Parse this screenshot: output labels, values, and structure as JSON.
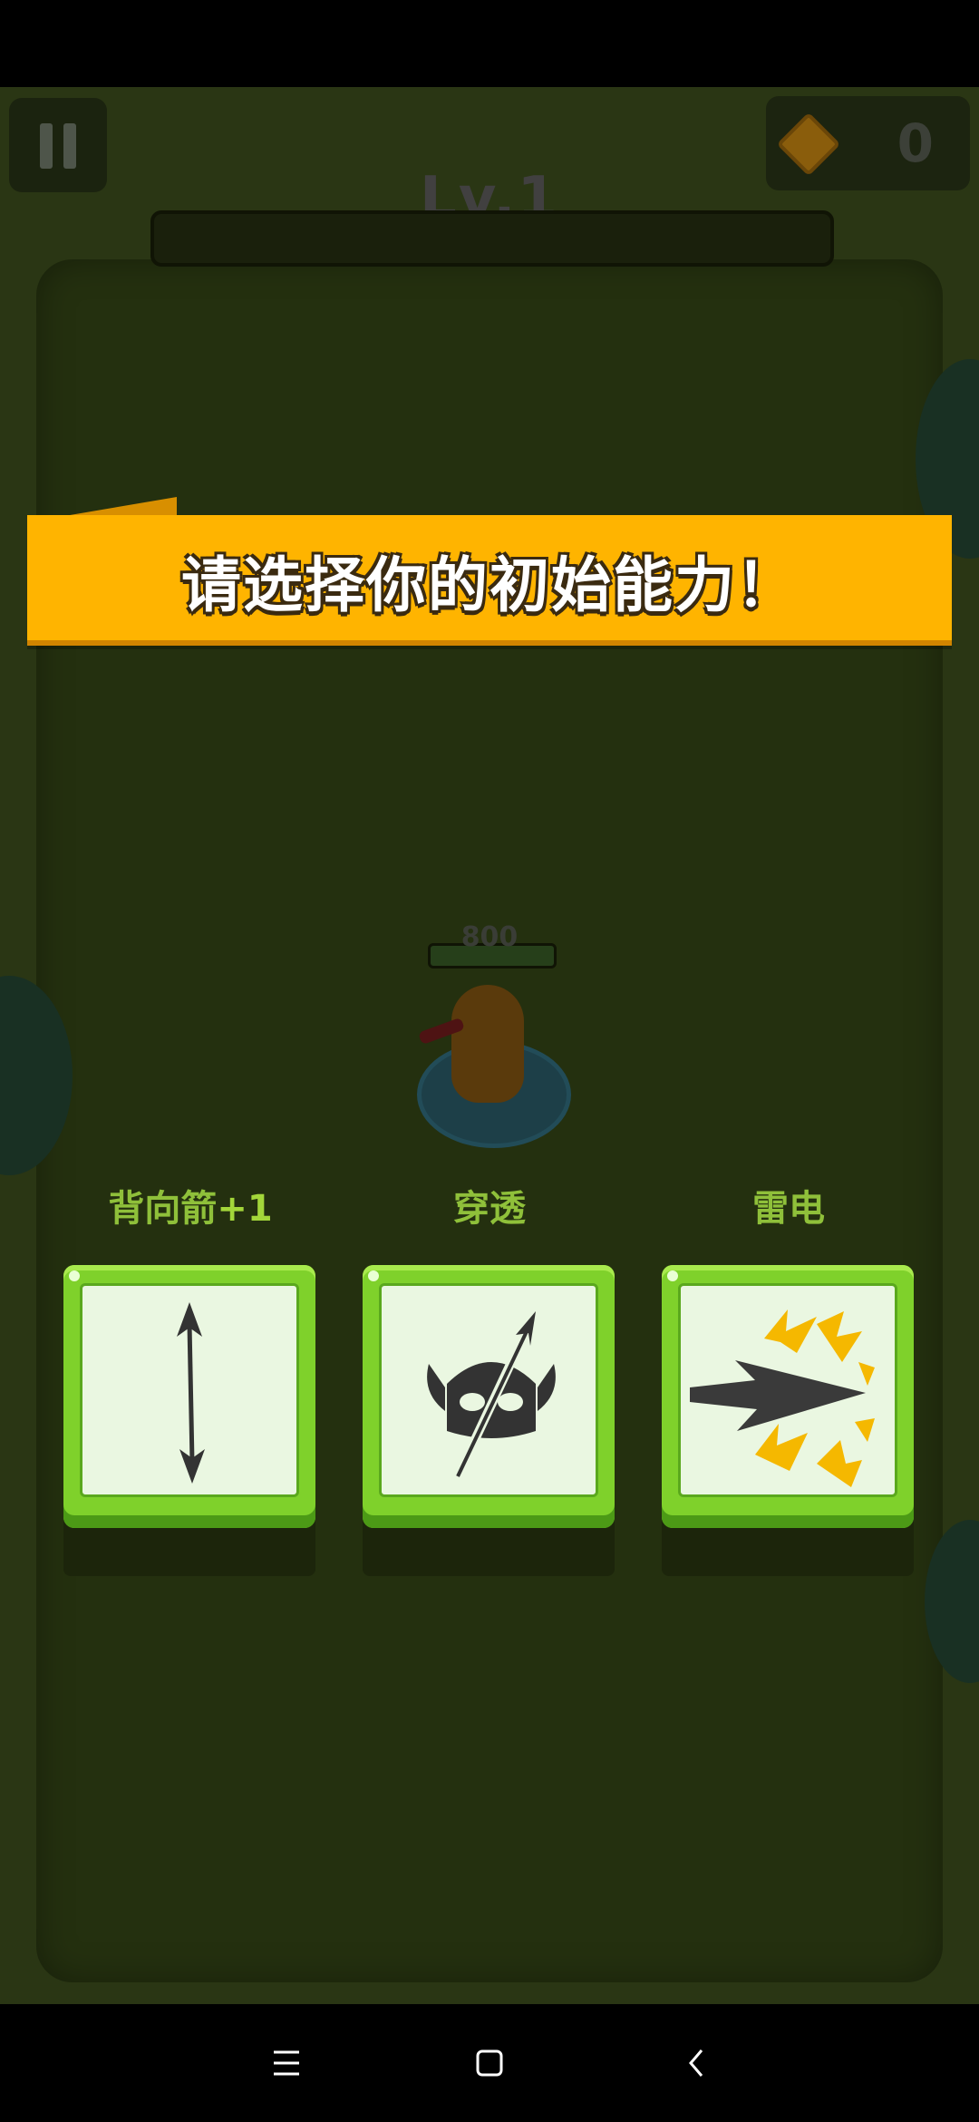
{
  "hud": {
    "level_label": "Lv.1",
    "gem_count": "0"
  },
  "banner": {
    "text": "请选择你的初始能力！"
  },
  "player": {
    "hp_value": "800"
  },
  "abilities": [
    {
      "label": "背向箭",
      "suffix": "+1",
      "icon": "double-arrow-icon"
    },
    {
      "label": "穿透",
      "suffix": "",
      "icon": "pierce-helmet-icon"
    },
    {
      "label": "雷电",
      "suffix": "",
      "icon": "lightning-arrow-icon"
    }
  ],
  "colors": {
    "banner": "#ffb400",
    "card_green": "#7fd12b",
    "label_green": "#8fc03a"
  },
  "nav": {
    "recents": "menu-icon",
    "home": "square-icon",
    "back": "back-chevron-icon"
  }
}
